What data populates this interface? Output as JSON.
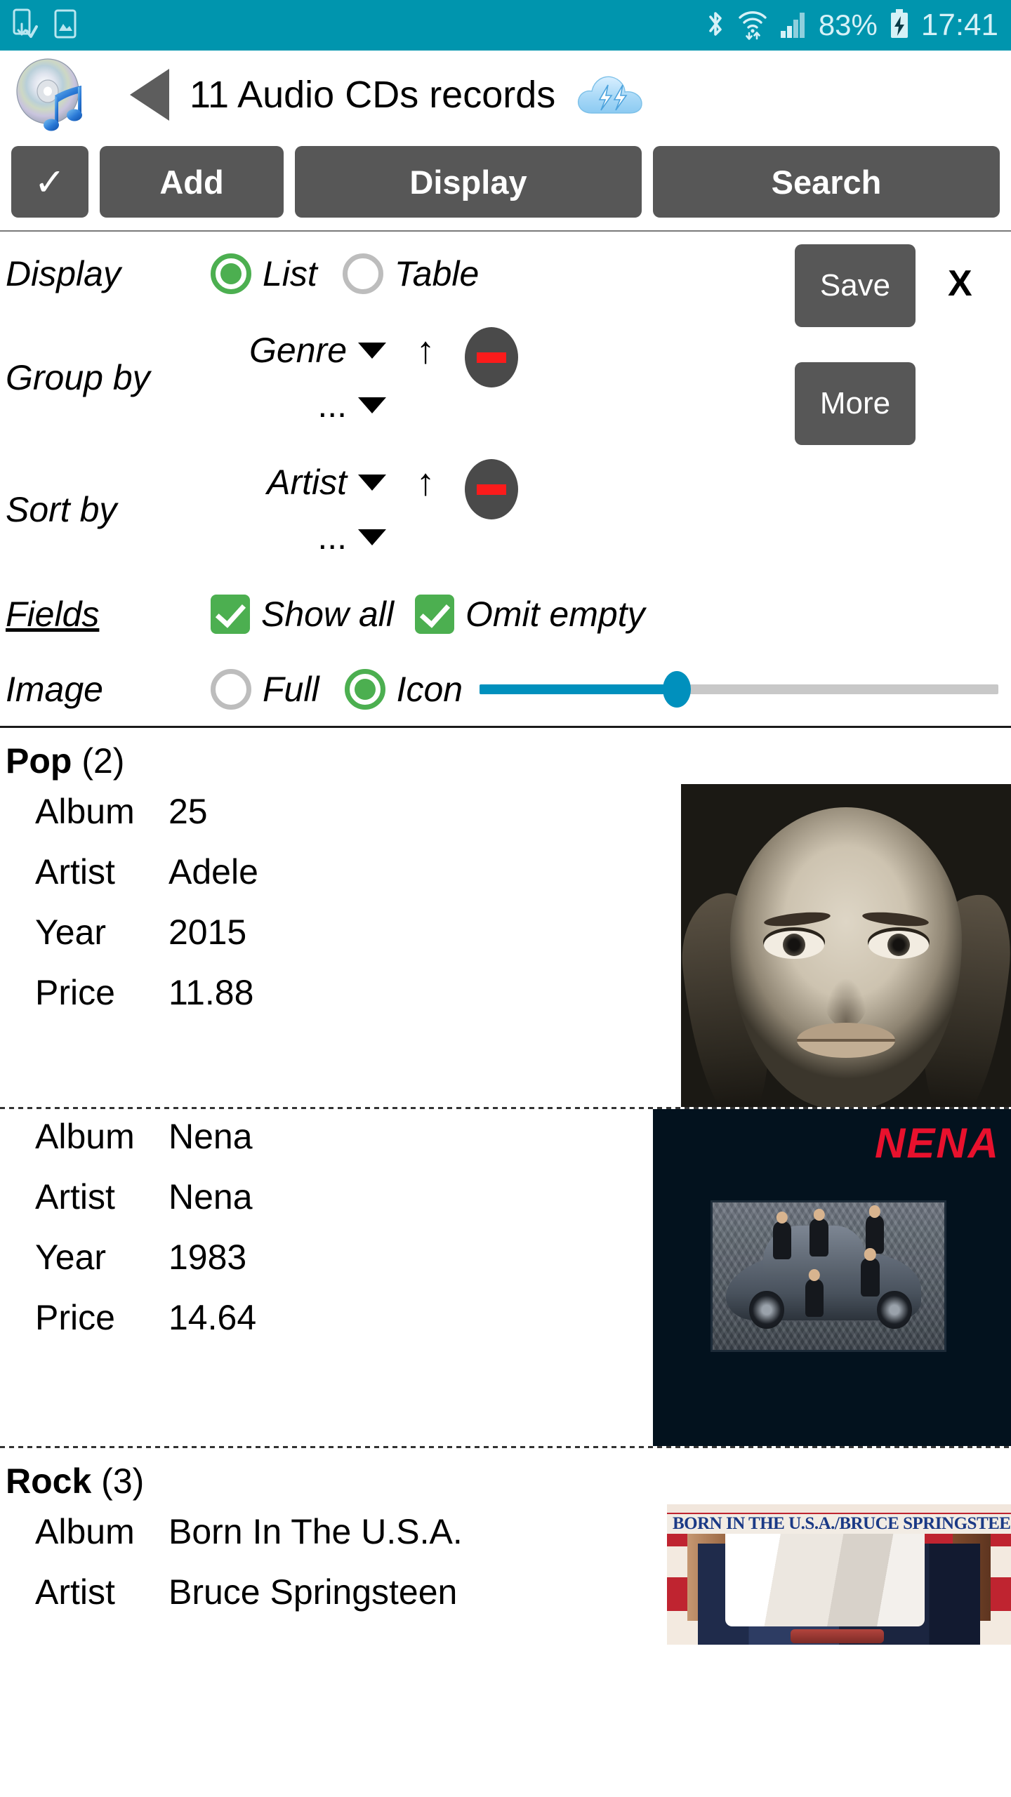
{
  "status_bar": {
    "icons_left": [
      "screenshot-capture-icon",
      "gallery-image-icon"
    ],
    "icons_right": [
      "bluetooth-icon",
      "wifi-icon",
      "cellular-signal-icon",
      "battery-charging-icon"
    ],
    "battery_percent": "83%",
    "clock": "17:41",
    "background_color": "#0095ae"
  },
  "title_bar": {
    "app_icon": "audio-cd-music-icon",
    "back_icon": "back-arrow-icon",
    "title": "11 Audio CDs records",
    "cloud_icon": "cloud-sync-icon"
  },
  "action_bar": {
    "check_label": "✓",
    "add_label": "Add",
    "display_label": "Display",
    "search_label": "Search"
  },
  "options": {
    "display": {
      "label": "Display",
      "option_list": "List",
      "option_table": "Table",
      "selected": "List"
    },
    "group_by": {
      "label": "Group by",
      "primary_value": "Genre",
      "secondary_value": "...",
      "direction_icon": "↑",
      "remove_icon": "minus-icon"
    },
    "sort_by": {
      "label": "Sort by",
      "primary_value": "Artist",
      "secondary_value": "...",
      "direction_icon": "↑",
      "remove_icon": "minus-icon"
    },
    "fields": {
      "label": "Fields",
      "show_all_label": "Show all",
      "show_all_checked": true,
      "omit_empty_label": "Omit empty",
      "omit_empty_checked": true
    },
    "image": {
      "label": "Image",
      "option_full": "Full",
      "option_icon": "Icon",
      "selected": "Icon",
      "slider_percent": 38
    },
    "side": {
      "save_label": "Save",
      "more_label": "More",
      "close_label": "X"
    },
    "accent_green": "#4caf50",
    "accent_blue": "#0090bd",
    "button_gray": "#575757"
  },
  "list": {
    "groups": [
      {
        "name": "Pop",
        "count": "(2)",
        "records": [
          {
            "art": "adele-25-cover",
            "fields": [
              {
                "label": "Album",
                "value": "25"
              },
              {
                "label": "Artist",
                "value": "Adele"
              },
              {
                "label": "Year",
                "value": "2015"
              },
              {
                "label": "Price",
                "value": "11.88"
              }
            ]
          },
          {
            "art": "nena-cover",
            "art_text": "NENA",
            "fields": [
              {
                "label": "Album",
                "value": "Nena"
              },
              {
                "label": "Artist",
                "value": "Nena"
              },
              {
                "label": "Year",
                "value": "1983"
              },
              {
                "label": "Price",
                "value": "14.64"
              }
            ]
          }
        ]
      },
      {
        "name": "Rock",
        "count": "(3)",
        "records": [
          {
            "art": "born-in-the-usa-cover",
            "art_text": "BORN IN THE U.S.A./BRUCE SPRINGSTEEN",
            "fields": [
              {
                "label": "Album",
                "value": "Born In The U.S.A."
              },
              {
                "label": "Artist",
                "value": "Bruce Springsteen"
              }
            ]
          }
        ]
      }
    ]
  }
}
